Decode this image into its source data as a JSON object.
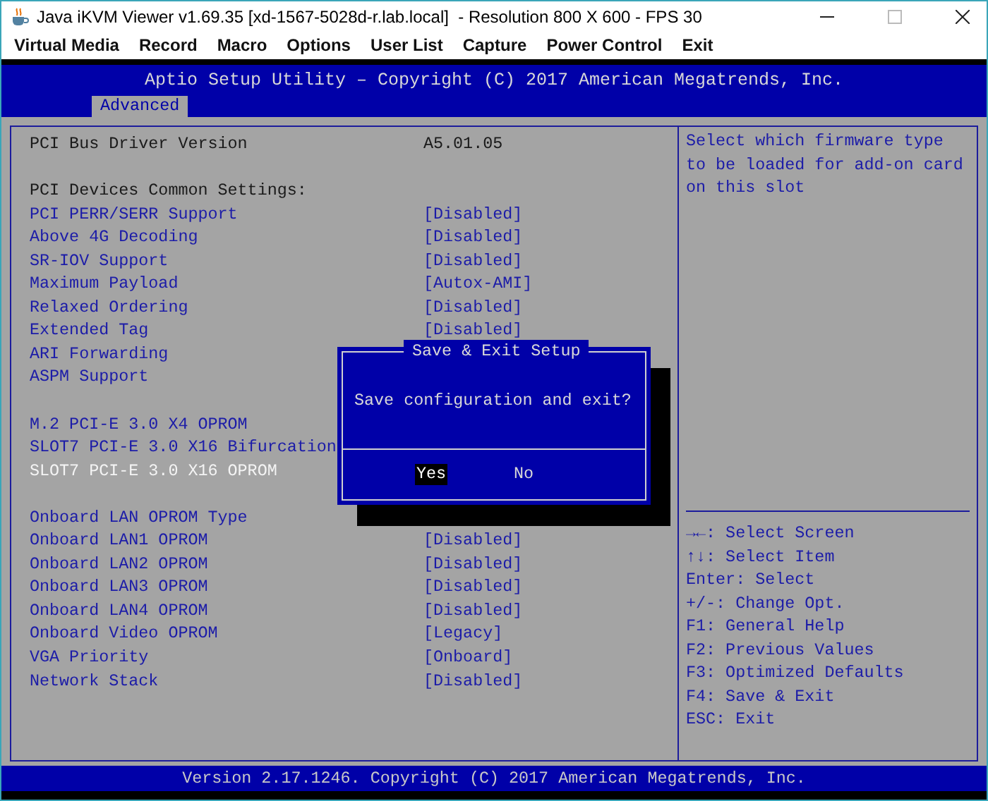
{
  "window": {
    "title": "Java iKVM Viewer v1.69.35 [xd-1567-5028d-r.lab.local]  - Resolution 800 X 600 - FPS 30"
  },
  "menu": [
    "Virtual Media",
    "Record",
    "Macro",
    "Options",
    "User List",
    "Capture",
    "Power Control",
    "Exit"
  ],
  "bios": {
    "title": "Aptio Setup Utility – Copyright (C) 2017 American Megatrends, Inc.",
    "tabs": [
      {
        "label": "Advanced",
        "selected": true
      }
    ],
    "rows": [
      {
        "kind": "info",
        "label": "PCI Bus Driver Version",
        "value": "A5.01.05",
        "selected": false
      },
      {
        "kind": "blank"
      },
      {
        "kind": "heading",
        "label": "PCI Devices Common Settings:",
        "selected": false
      },
      {
        "kind": "setting",
        "label": "PCI PERR/SERR Support",
        "value": "[Disabled]",
        "selected": false
      },
      {
        "kind": "setting",
        "label": "Above 4G Decoding",
        "value": "[Disabled]",
        "selected": false
      },
      {
        "kind": "setting",
        "label": "SR-IOV Support",
        "value": "[Disabled]",
        "selected": false
      },
      {
        "kind": "setting",
        "label": "Maximum Payload",
        "value": "[Autox-AMI]",
        "selected": false
      },
      {
        "kind": "setting",
        "label": "Relaxed Ordering",
        "value": "[Disabled]",
        "selected": false
      },
      {
        "kind": "setting",
        "label": "Extended Tag",
        "value": "[Disabled]",
        "selected": false
      },
      {
        "kind": "setting",
        "label": "ARI Forwarding",
        "selected": false
      },
      {
        "kind": "setting",
        "label": "ASPM Support",
        "selected": false
      },
      {
        "kind": "blank"
      },
      {
        "kind": "setting",
        "label": "M.2 PCI-E 3.0 X4 OPROM",
        "selected": false
      },
      {
        "kind": "setting",
        "label": "SLOT7 PCI-E 3.0 X16 Bifurcation",
        "selected": false
      },
      {
        "kind": "setting",
        "label": "SLOT7 PCI-E 3.0 X16 OPROM",
        "selected": true
      },
      {
        "kind": "blank"
      },
      {
        "kind": "setting",
        "label": "Onboard LAN OPROM Type",
        "selected": false
      },
      {
        "kind": "setting",
        "label": "Onboard LAN1 OPROM",
        "value": "[Disabled]",
        "selected": false
      },
      {
        "kind": "setting",
        "label": "Onboard LAN2 OPROM",
        "value": "[Disabled]",
        "selected": false
      },
      {
        "kind": "setting",
        "label": "Onboard LAN3 OPROM",
        "value": "[Disabled]",
        "selected": false
      },
      {
        "kind": "setting",
        "label": "Onboard LAN4 OPROM",
        "value": "[Disabled]",
        "selected": false
      },
      {
        "kind": "setting",
        "label": "Onboard Video OPROM",
        "value": "[Legacy]",
        "selected": false
      },
      {
        "kind": "setting",
        "label": "VGA Priority",
        "value": "[Onboard]",
        "selected": false
      },
      {
        "kind": "setting",
        "label": "Network Stack",
        "value": "[Disabled]",
        "selected": false
      }
    ],
    "help": "Select which firmware type to be loaded for add-on card on this slot",
    "keys": [
      "→←: Select Screen",
      "↑↓: Select Item",
      "Enter: Select",
      "+/-: Change Opt.",
      "F1: General Help",
      "F2: Previous Values",
      "F3: Optimized Defaults",
      "F4: Save & Exit",
      "ESC: Exit"
    ],
    "footer": "Version 2.17.1246. Copyright (C) 2017 American Megatrends, Inc."
  },
  "dialog": {
    "title": "Save & Exit Setup",
    "message": "Save configuration and exit?",
    "buttons": [
      {
        "label": "Yes",
        "selected": true
      },
      {
        "label": "No",
        "selected": false
      }
    ]
  }
}
